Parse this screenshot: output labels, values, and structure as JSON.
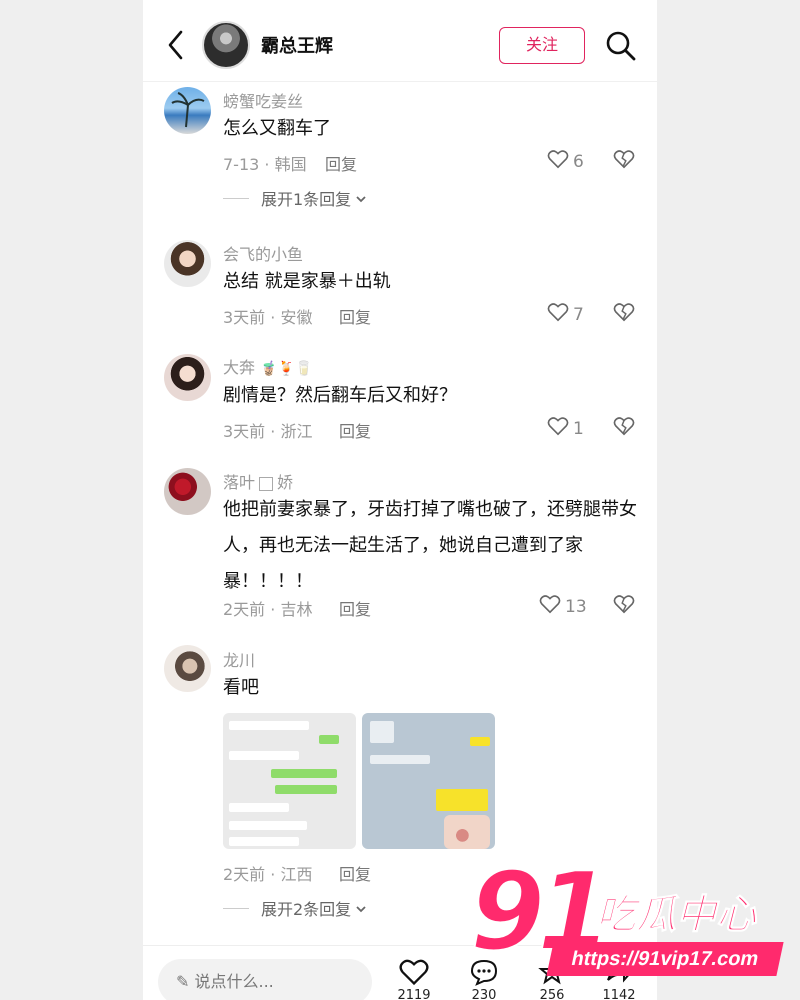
{
  "header": {
    "name": "霸总王辉",
    "follow_label": "关注"
  },
  "comments": [
    {
      "user": "螃蟹吃姜丝",
      "text": "怎么又翻车了",
      "meta": "7-13 · 韩国",
      "reply": "回复",
      "likes": "6",
      "expand": "展开1条回复"
    },
    {
      "user": "会飞的小鱼",
      "text": "总结 就是家暴＋出轨",
      "meta": "3天前 · 安徽",
      "reply": "回复",
      "likes": "7"
    },
    {
      "user": "大奔",
      "user_emojis": "🧋🍹🥛",
      "text": "剧情是？然后翻车后又和好？",
      "meta": "3天前 · 浙江",
      "reply": "回复",
      "likes": "1"
    },
    {
      "user_a": "落叶",
      "user_b": "娇",
      "text": "他把前妻家暴了，牙齿打掉了嘴也破了，还劈腿带女人，再也无法一起生活了，她说自己遭到了家暴！！！！",
      "meta": "2天前 · 吉林",
      "reply": "回复",
      "likes": "13"
    },
    {
      "user": "龙川",
      "text": "看吧",
      "meta": "2天前 · 江西",
      "reply": "回复",
      "expand": "展开2条回复"
    }
  ],
  "bottom": {
    "placeholder": "说点什么...",
    "counts": [
      "2119",
      "230",
      "256",
      "1142"
    ]
  },
  "watermark": {
    "brand": "91",
    "cn": "吃瓜中心",
    "url": "https://91vip17.com"
  },
  "colors": {
    "accent": "#e0245e",
    "watermark": "#ff2a6d"
  }
}
